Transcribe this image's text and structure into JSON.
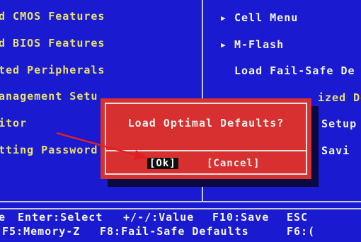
{
  "left_menu": [
    {
      "label": "d CMOS Features"
    },
    {
      "label": "d BIOS Features"
    },
    {
      "label": "ted Peripherals"
    },
    {
      "label": "anagement Setu"
    },
    {
      "label": "itor"
    },
    {
      "label": "tting Password"
    }
  ],
  "right_menu": [
    {
      "label": "Cell Menu",
      "submenu": true
    },
    {
      "label": "M-Flash",
      "submenu": true
    },
    {
      "label": "Load Fail-Safe De",
      "submenu": false
    },
    {
      "label": "ized De",
      "submenu": false
    },
    {
      "label": "t Setup",
      "submenu": false
    },
    {
      "label": "t Savi",
      "submenu": false
    }
  ],
  "dialog": {
    "title": "Load Optimal Defaults?",
    "ok_label": "[Ok]",
    "cancel_label": "[Cancel]"
  },
  "hotkeys": {
    "row1": {
      "navigate": "e",
      "enter": "Enter:Select",
      "value": "+/-/:Value",
      "save": "F10:Save",
      "esc": "ESC"
    },
    "row2": {
      "memory": "F5:Memory-Z",
      "failsafe": "F8:Fail-Safe Defaults",
      "f6": "F6:("
    }
  },
  "colors": {
    "background": "#1a1ad0",
    "left_text": "#e8e070",
    "right_text": "#f2f2f2",
    "dialog": "#d83030",
    "annotation_arrow": "#e02020"
  },
  "icons": {
    "submenu_indicator": "triangle-right-icon",
    "annotation": "red-arrow-icon"
  }
}
